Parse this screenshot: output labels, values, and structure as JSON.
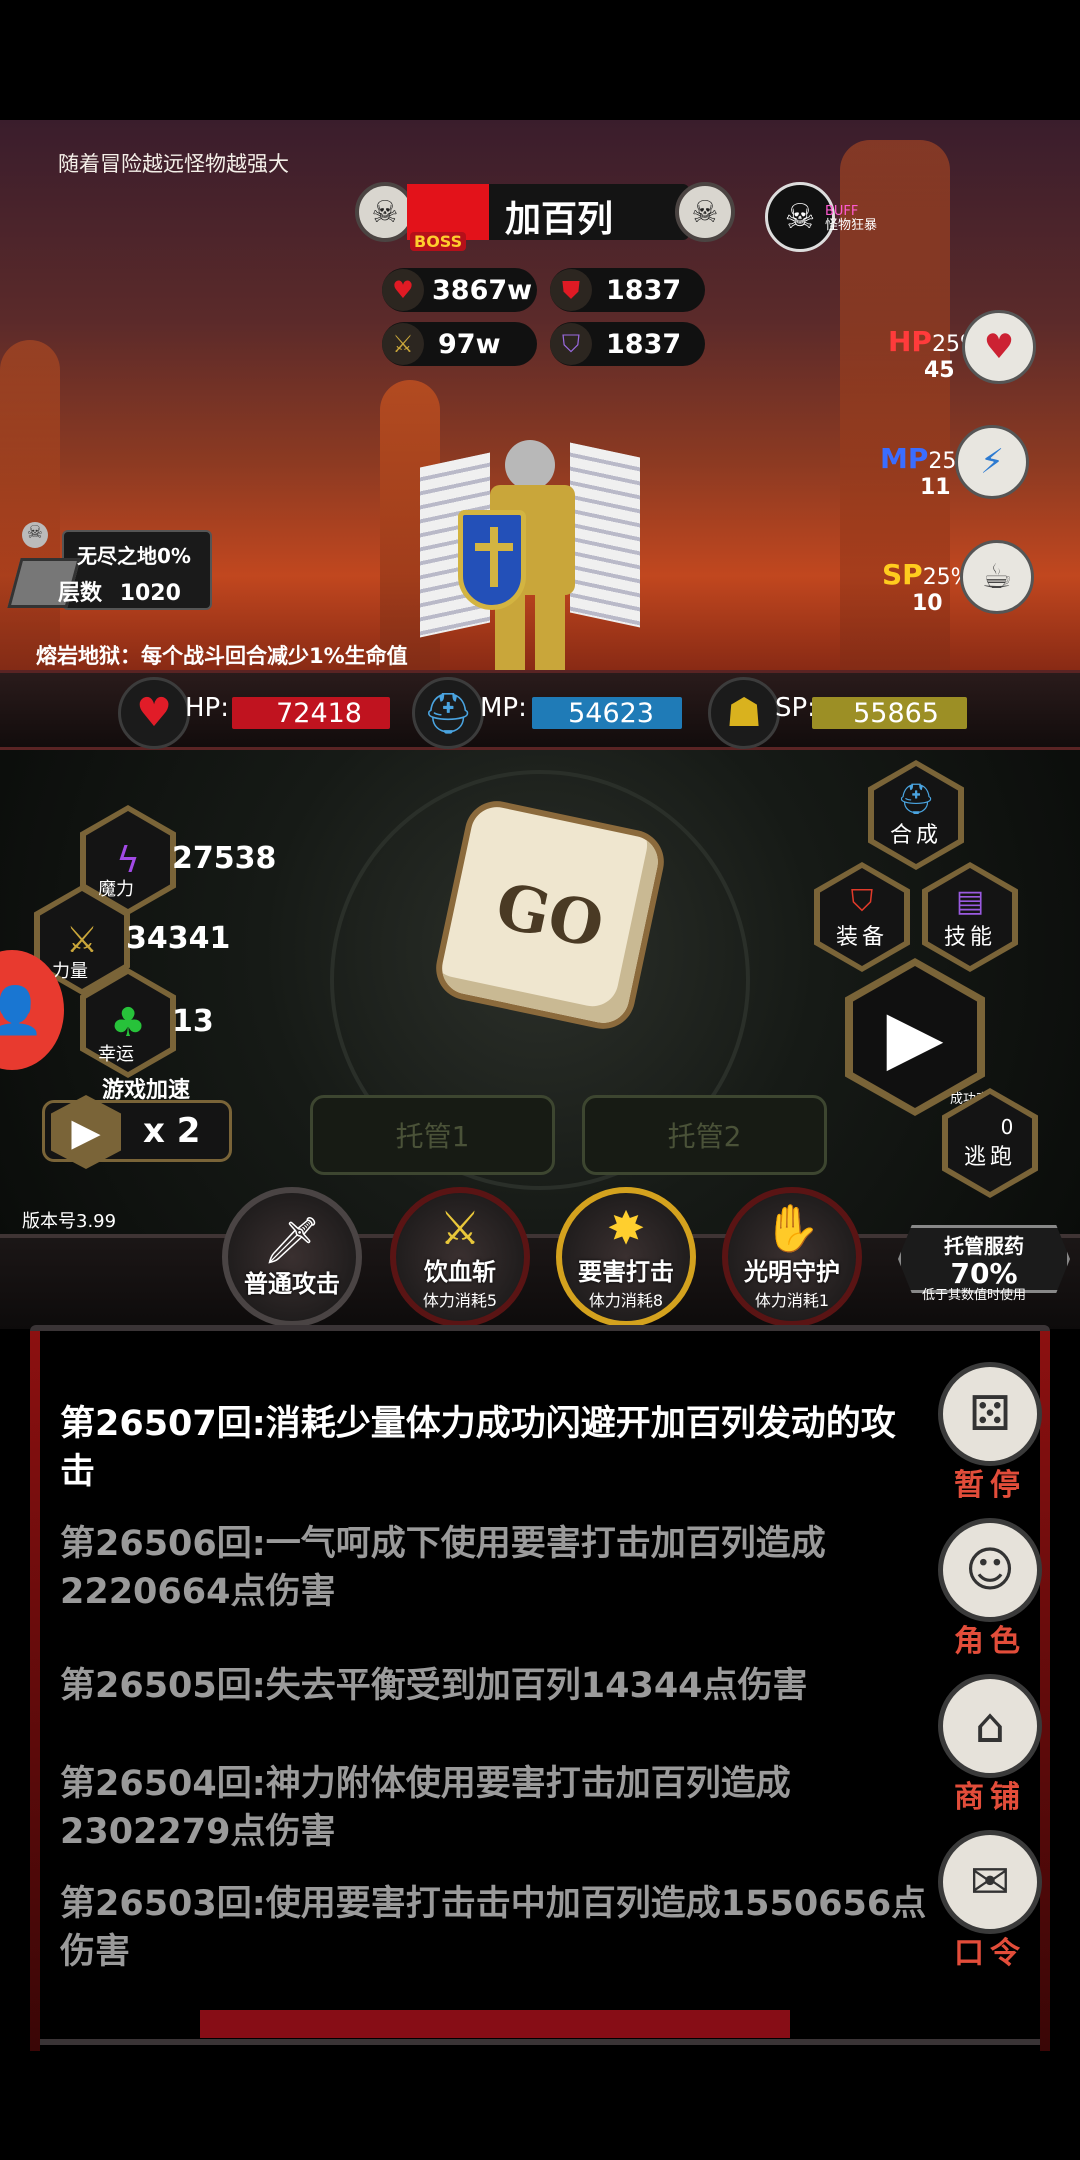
{
  "scene": {
    "tip": "随着冒险越远怪物越强大",
    "boss": {
      "name": "加百列",
      "tag": "BOSS",
      "hp": "3867w",
      "def": "1837",
      "atk": "97w",
      "mdef": "1837"
    },
    "buff": {
      "label": "BUFF",
      "sub": "怪物狂暴"
    },
    "potions": [
      {
        "key": "HP",
        "pct": "25%",
        "count": "45",
        "color": "#ff3b3b"
      },
      {
        "key": "MP",
        "pct": "25%",
        "count": "11",
        "color": "#3a6dff"
      },
      {
        "key": "SP",
        "pct": "25%",
        "count": "10",
        "color": "#ffcc1e"
      }
    ],
    "floor": {
      "name": "无尽之地0%",
      "label": "层数",
      "value": "1020"
    },
    "lava_tip": "熔岩地狱：每个战斗回合减少1%生命值"
  },
  "hud": {
    "hp_label": "HP:",
    "hp_value": "72418",
    "mp_label": "MP:",
    "mp_value": "54623",
    "sp_label": "SP:",
    "sp_value": "55865",
    "colors": {
      "hp": "#c0131f",
      "mp": "#1f7bb7",
      "sp": "#9c8f25"
    }
  },
  "stats": {
    "magic": {
      "label": "魔力",
      "value": "27538"
    },
    "power": {
      "label": "力量",
      "value": "34341"
    },
    "luck": {
      "label": "幸运",
      "value": "13"
    }
  },
  "speed": {
    "label": "游戏加速",
    "value": "x 2"
  },
  "dice_text": "GO",
  "actions": {
    "compose": "合成",
    "equip": "装备",
    "skill": "技能",
    "escape": "逃跑",
    "escape_rate_label": "成功率:",
    "escape_rate": "0"
  },
  "trust": {
    "slot1": "托管1",
    "slot2": "托管2"
  },
  "version": "版本号3.99",
  "skills": [
    {
      "name": "普通攻击",
      "cost": ""
    },
    {
      "name": "饮血斩",
      "cost": "体力消耗5"
    },
    {
      "name": "要害打击",
      "cost": "体力消耗8"
    },
    {
      "name": "光明守护",
      "cost": "体力消耗1"
    }
  ],
  "auto_potion": {
    "label": "托管服药",
    "value": "70%",
    "note": "低于其数值时使用"
  },
  "log": [
    {
      "text": "第26507回:消耗少量体力成功闪避开加百列发动的攻击",
      "color": "#ffffff"
    },
    {
      "text": "第26506回:一气呵成下使用要害打击加百列造成2220664点伤害",
      "color": "#9a9a9a"
    },
    {
      "text": "第26505回:失去平衡受到加百列14344点伤害",
      "color": "#9a9a9a"
    },
    {
      "text": "第26504回:神力附体使用要害打击加百列造成2302279点伤害",
      "color": "#9a9a9a"
    },
    {
      "text": "第26503回:使用要害打击击中加百列造成1550656点伤害",
      "color": "#9a9a9a"
    }
  ],
  "menu": {
    "pause": "暂停",
    "role": "角色",
    "shop": "商铺",
    "code": "口令"
  }
}
